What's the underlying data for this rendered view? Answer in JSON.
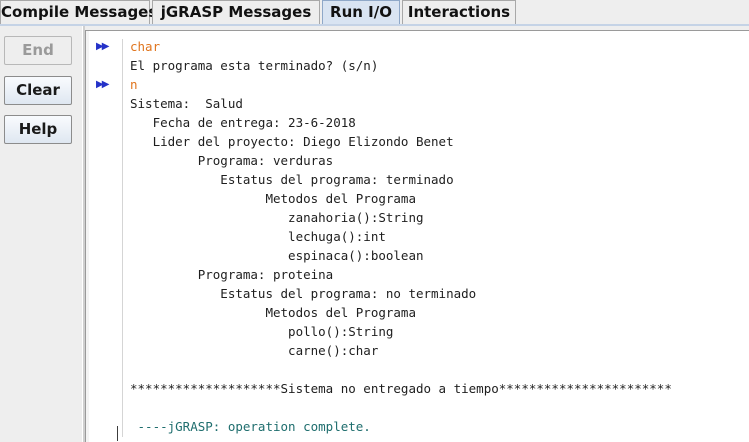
{
  "tabs": [
    {
      "label": "Compile Messages",
      "active": false
    },
    {
      "label": "jGRASP Messages",
      "active": false
    },
    {
      "label": "Run I/O",
      "active": true
    },
    {
      "label": "Interactions",
      "active": false
    }
  ],
  "buttons": {
    "end": "End",
    "clear": "Clear",
    "help": "Help"
  },
  "console": {
    "lines": [
      {
        "text": "char",
        "kind": "input",
        "marker": true
      },
      {
        "text": "El programa esta terminado? (s/n)",
        "kind": "output",
        "marker": false
      },
      {
        "text": "n",
        "kind": "input",
        "marker": true
      },
      {
        "text": "Sistema:  Salud",
        "kind": "output",
        "marker": false
      },
      {
        "text": "   Fecha de entrega: 23-6-2018",
        "kind": "output",
        "marker": false
      },
      {
        "text": "   Lider del proyecto: Diego Elizondo Benet",
        "kind": "output",
        "marker": false
      },
      {
        "text": "         Programa: verduras",
        "kind": "output",
        "marker": false
      },
      {
        "text": "            Estatus del programa: terminado",
        "kind": "output",
        "marker": false
      },
      {
        "text": "                  Metodos del Programa",
        "kind": "output",
        "marker": false
      },
      {
        "text": "                     zanahoria():String",
        "kind": "output",
        "marker": false
      },
      {
        "text": "                     lechuga():int",
        "kind": "output",
        "marker": false
      },
      {
        "text": "                     espinaca():boolean",
        "kind": "output",
        "marker": false
      },
      {
        "text": "         Programa: proteina",
        "kind": "output",
        "marker": false
      },
      {
        "text": "            Estatus del programa: no terminado",
        "kind": "output",
        "marker": false
      },
      {
        "text": "                  Metodos del Programa",
        "kind": "output",
        "marker": false
      },
      {
        "text": "                     pollo():String",
        "kind": "output",
        "marker": false
      },
      {
        "text": "                     carne():char",
        "kind": "output",
        "marker": false
      },
      {
        "text": "",
        "kind": "output",
        "marker": false
      },
      {
        "text": "********************Sistema no entregado a tiempo***********************",
        "kind": "output",
        "marker": false
      },
      {
        "text": "",
        "kind": "output",
        "marker": false
      },
      {
        "text": " ----jGRASP: operation complete.",
        "kind": "status",
        "marker": false
      }
    ],
    "marker_glyph": "▶▶"
  },
  "colors": {
    "input_text": "#e0751e",
    "status_text": "#1f6e6e",
    "marker": "#2432c8",
    "active_tab": "#d9e4f2"
  }
}
